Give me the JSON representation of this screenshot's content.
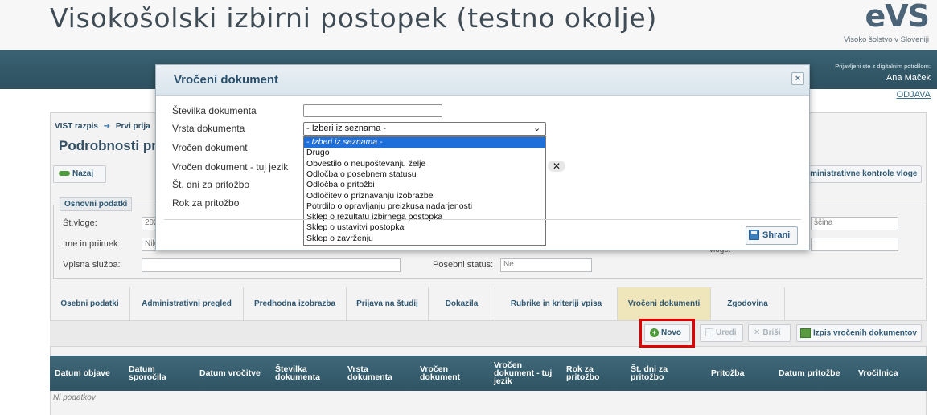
{
  "header": {
    "title": "Visokošolski izbirni postopek (testno okolje)",
    "logo": "eVS",
    "logo_subtitle": "Visoko šolstvo v Sloveniji"
  },
  "user": {
    "login_info": "Prijavljeni ste z digitalnim potrdilom:",
    "name": "Ana Maček",
    "logout": "ODJAVA"
  },
  "breadcrumb": {
    "items": [
      "VIST razpis",
      "Prvi prija"
    ],
    "separator": "➔"
  },
  "page": {
    "heading": "Podrobnosti prij",
    "back_label": "Nazaj",
    "admin_checks_label": "dministrativne kontrole vloge"
  },
  "basic_data": {
    "legend": "Osnovni podatki",
    "application_no_label": "Št.vloge:",
    "application_no_value": "202",
    "name_label": "Ime in priimek:",
    "name_value": "Nik",
    "enrollment_service_label": "Vpisna služba:",
    "enrollment_service_value": "",
    "special_status_label": "Posebni status:",
    "special_status_value": "Ne",
    "right_value_1": "ščina",
    "right_label_2": "vloge:",
    "right_value_2": ""
  },
  "tabs": [
    {
      "label": "Osebni podatki",
      "active": false
    },
    {
      "label": "Administrativni pregled",
      "active": false
    },
    {
      "label": "Predhodna izobrazba",
      "active": false
    },
    {
      "label": "Prijava na študij",
      "active": false
    },
    {
      "label": "Dokazila",
      "active": false
    },
    {
      "label": "Rubrike in kriteriji vpisa",
      "active": false
    },
    {
      "label": "Vročeni dokumenti",
      "active": true
    },
    {
      "label": "Zgodovina",
      "active": false
    }
  ],
  "toolbar": {
    "new_label": "Novo",
    "edit_label": "Uredi",
    "delete_label": "Briši",
    "print_label": "Izpis vročenih dokumentov"
  },
  "table": {
    "columns": [
      "Datum objave",
      "Datum\nsporočila",
      "Datum vročitve",
      "Številka\ndokumenta",
      "Vrsta\ndokumenta",
      "Vročen\ndokument",
      "Vročen\ndokument - tuj\njezik",
      "Rok za\npritožbo",
      "Št. dni za\npritožbo",
      "Pritožba",
      "Datum pritožbe",
      "Vročilnica"
    ],
    "empty_text": "Ni podatkov"
  },
  "modal": {
    "title": "Vročeni dokument",
    "labels": {
      "doc_number": "Številka dokumenta",
      "doc_type": "Vrsta dokumenta",
      "served_doc": "Vročen dokument",
      "served_doc_foreign": "Vročen dokument - tuj jezik",
      "days_appeal": "Št. dni za pritožbo",
      "appeal_deadline": "Rok za pritožbo"
    },
    "doc_number_value": "",
    "doc_type_selected": "- Izberi iz seznama -",
    "doc_type_options": [
      "- Izberi iz seznama -",
      "Drugo",
      "Obvestilo o neupoštevanju želje",
      "Odločba o posebnem statusu",
      "Odločba o pritožbi",
      "Odločitev o priznavanju izobrazbe",
      "Potrdilo o opravljanju preizkusa nadarjenosti",
      "Sklep o rezultatu izbirnega postopka",
      "Sklep o ustavitvi postopka",
      "Sklep o zavrženju"
    ],
    "save_label": "Shrani",
    "close_symbol": "×",
    "clear_symbol": "✕"
  },
  "colors": {
    "header_bar": "#2f5464",
    "active_tab": "#f0e6bb",
    "highlight": "#e00000",
    "option_selected": "#1e6fd9"
  }
}
